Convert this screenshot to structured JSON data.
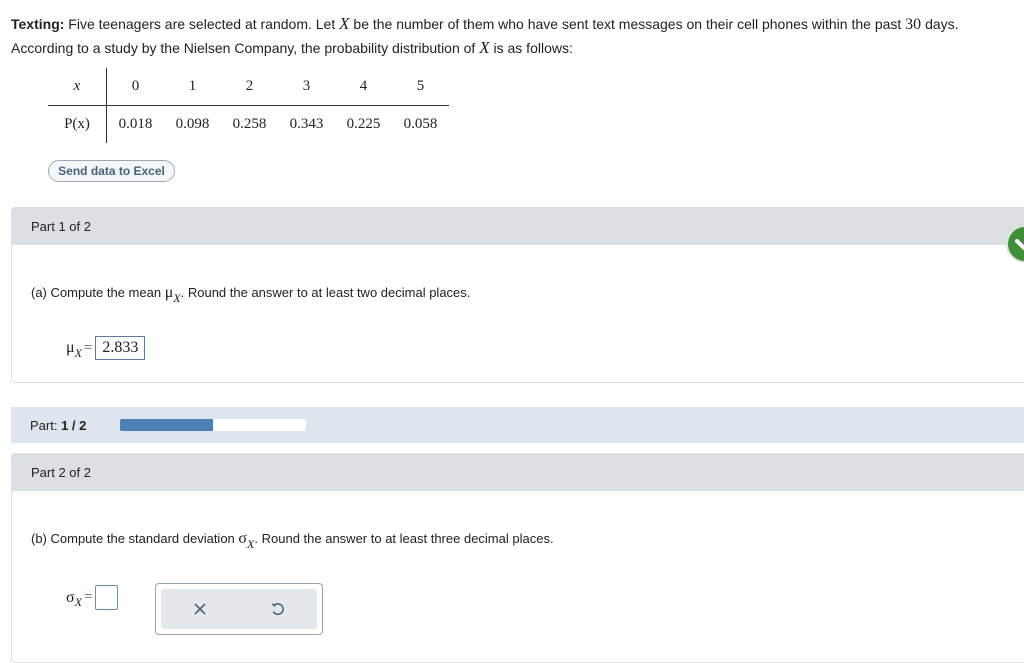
{
  "intro": {
    "label": "Texting:",
    "line1_a": "Five teenagers are selected at random. Let",
    "var_x": "X",
    "line1_b": "be the number of them who have sent text messages on their cell phones within the past",
    "days_num": "30",
    "line1_c": "days.",
    "line2_a": "According to a study by the Nielsen Company, the probability distribution of",
    "line2_b": "is as follows:"
  },
  "table": {
    "row_x_label": "x",
    "row_p_label": "P(x)",
    "x_values": [
      "0",
      "1",
      "2",
      "3",
      "4",
      "5"
    ],
    "p_values": [
      "0.018",
      "0.098",
      "0.258",
      "0.343",
      "0.225",
      "0.058"
    ]
  },
  "excel_button": "Send data to Excel",
  "part1": {
    "header": "Part 1 of 2",
    "question_a": "(a) Compute the mean",
    "mu_symbol": "μ",
    "sub": "X",
    "question_b": ". Round the answer to at least two decimal places.",
    "answer_value": "2.833",
    "eq": "="
  },
  "progress": {
    "label": "Part:",
    "value": "1 / 2",
    "fraction": 0.5
  },
  "part2": {
    "header": "Part 2 of 2",
    "question_a": "(b) Compute the standard deviation",
    "sigma_symbol": "σ",
    "sub": "X",
    "question_b": ". Round the answer to at least three decimal places.",
    "answer_value": "",
    "eq": "="
  },
  "tools": {
    "clear_icon": "close-icon",
    "undo_icon": "undo-icon"
  },
  "colors": {
    "progress_fill": "#4e7fb5",
    "check_green": "#3f8f3a"
  }
}
